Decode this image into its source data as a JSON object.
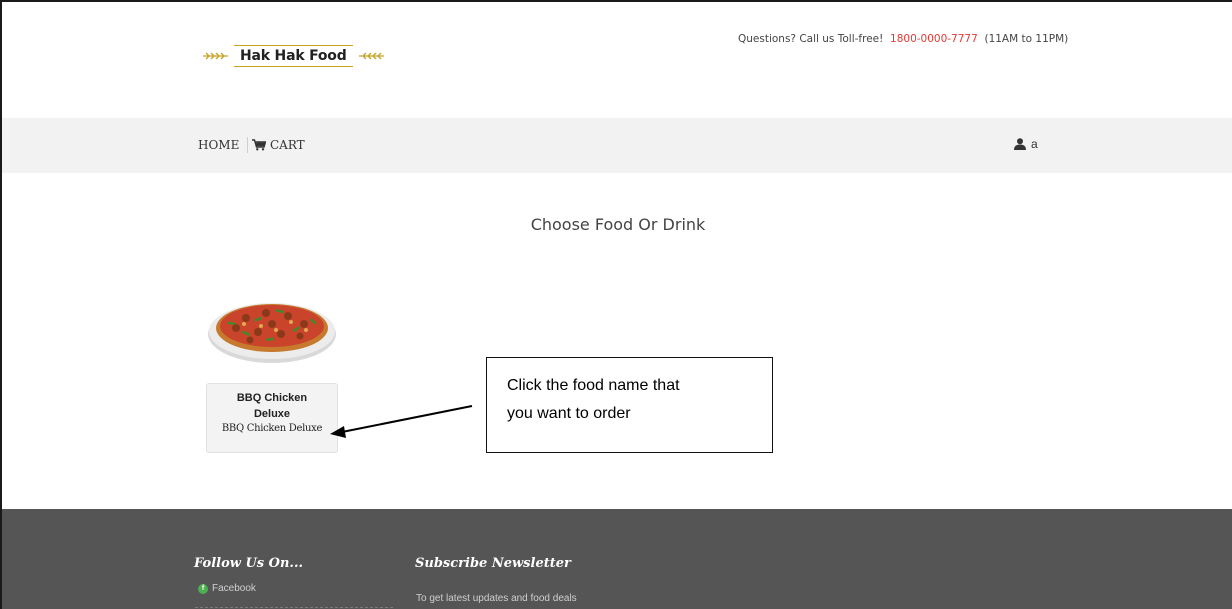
{
  "header": {
    "brand": "Hak Hak Food",
    "questions_text": "Questions? Call us Toll-free!",
    "phone": "1800-0000-7777",
    "hours": "(11AM to 11PM)",
    "accent_color": "#e53935"
  },
  "nav": {
    "home_label": "HOME",
    "cart_label": "CART",
    "cart_icon": "cart-icon",
    "user_icon": "user-icon",
    "user_name": "a"
  },
  "main": {
    "title": "Choose Food Or Drink",
    "food_items": [
      {
        "title": "BBQ Chicken Deluxe",
        "subtitle": "BBQ Chicken Deluxe",
        "image_icon": "pizza-image"
      }
    ]
  },
  "annotation": {
    "line1": "Click the food name that",
    "line2": "you want to order"
  },
  "footer": {
    "follow_heading": "Follow Us On...",
    "facebook_label": "Facebook",
    "subscribe_heading": "Subscribe Newsletter",
    "subscribe_text": "To get latest updates and food deals"
  }
}
